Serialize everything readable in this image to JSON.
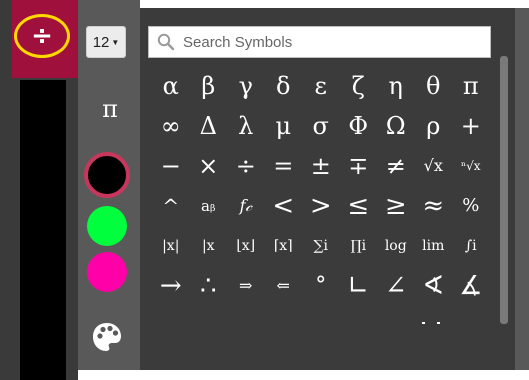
{
  "sidebar": {
    "divide_label": "÷",
    "size_value": "12",
    "pi_label": "π"
  },
  "colors": {
    "accent": "#a0103d",
    "highlight_ring": "#ffd800",
    "swatch_black": "#000000",
    "swatch_green": "#00ff3c",
    "swatch_pink": "#ff00a8"
  },
  "search": {
    "placeholder": "Search Symbols"
  },
  "symbols": [
    [
      "α",
      "β",
      "γ",
      "δ",
      "ε",
      "ζ",
      "η",
      "θ",
      "π"
    ],
    [
      "∞",
      "Δ",
      "λ",
      "μ",
      "σ",
      "Φ",
      "Ω",
      "ρ",
      "+"
    ],
    [
      "−",
      "×",
      "÷",
      "=",
      "±",
      "∓",
      "≠",
      "√x",
      "ⁿ√x"
    ],
    [
      "^",
      "aᵦ",
      "f𝒸",
      "<",
      ">",
      "≤",
      "≥",
      "≈",
      "%"
    ],
    [
      "|x|",
      "|x",
      "⌊x⌋",
      "⌈x⌉",
      "∑i",
      "∏i",
      "log",
      "lim",
      "∫i"
    ],
    [
      "→",
      "∴",
      "⇒",
      "⇐",
      "°",
      "∟",
      "∠",
      "∢",
      "∡"
    ]
  ]
}
